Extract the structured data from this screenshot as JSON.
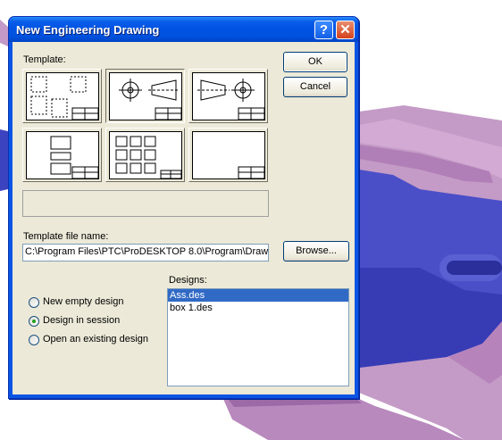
{
  "window": {
    "title": "New Engineering Drawing",
    "help_glyph": "?",
    "close_glyph": "✕"
  },
  "template_section": {
    "label": "Template:",
    "templates": [
      "blank-layout",
      "front-side-view",
      "side-front-view",
      "single-view",
      "multi-grid",
      "empty-frame"
    ],
    "selected_index": 1
  },
  "file_name": {
    "label": "Template file name:",
    "value": "C:\\Program Files\\PTC\\ProDESKTOP 8.0\\Program\\Drawi"
  },
  "buttons": {
    "ok": "OK",
    "cancel": "Cancel",
    "browse": "Browse..."
  },
  "options": {
    "items": [
      {
        "label": "New empty design",
        "checked": false
      },
      {
        "label": "Design in session",
        "checked": true
      },
      {
        "label": "Open an existing design",
        "checked": false
      }
    ]
  },
  "designs": {
    "label": "Designs:",
    "items": [
      "Ass.des",
      "box 1.des"
    ],
    "selected_index": 0
  },
  "colors": {
    "titlebar": "#0054e3",
    "dialog_face": "#ece9d8",
    "selection": "#316ac5",
    "model_blue": "#4a4fc6",
    "model_pink": "#c79ac8"
  }
}
